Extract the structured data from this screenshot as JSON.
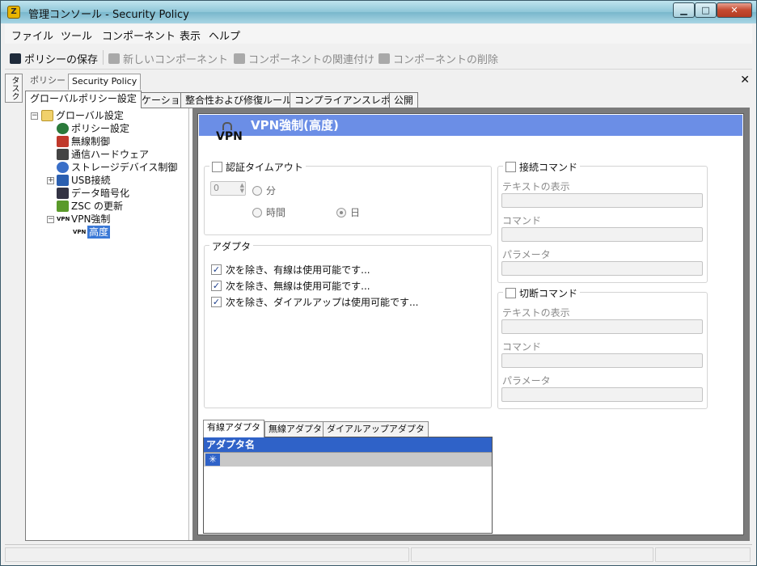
{
  "window": {
    "title": "管理コンソール - Security Policy",
    "min": "▁",
    "max": "□",
    "close": "✕"
  },
  "menu": [
    "ファイル",
    "ツール",
    "コンポーネント",
    "表示",
    "ヘルプ"
  ],
  "toolbar": {
    "save": "ポリシーの保存",
    "new_component": "新しいコンポーネント",
    "associate": "コンポーネントの関連付け",
    "delete": "コンポーネントの削除"
  },
  "sidetab": "タスク",
  "doc_tabs": [
    "ポリシー",
    "Security Policy"
  ],
  "main_tabs": [
    "グローバルポリシー設定",
    "ロケーション",
    "整合性および修復ルール",
    "コンプライアンスレポート",
    "公開"
  ],
  "tree": {
    "root": "グローバル設定",
    "items": [
      "ポリシー設定",
      "無線制御",
      "通信ハードウェア",
      "ストレージデバイス制御",
      "USB接続",
      "データ暗号化",
      "ZSC の更新",
      "VPN強制"
    ],
    "sub": "高度"
  },
  "panel": {
    "logo": "VPN",
    "header": "VPN強制(高度)",
    "auth_timeout": {
      "label": "認証タイムアウト",
      "spinner_value": "0",
      "minutes": "分",
      "hours": "時間",
      "days": "日",
      "selected": "日"
    },
    "adapter": {
      "label": "アダプタ",
      "options": [
        "次を除き、有線は使用可能です...",
        "次を除き、無線は使用可能です...",
        "次を除き、ダイアルアップは使用可能です..."
      ]
    },
    "connect_cmd": {
      "label": "接続コマンド",
      "display_text": "テキストの表示",
      "command": "コマンド",
      "params": "パラメータ"
    },
    "disconnect_cmd": {
      "label": "切断コマンド",
      "display_text": "テキストの表示",
      "command": "コマンド",
      "params": "パラメータ"
    },
    "bottom_tabs": [
      "有線アダプタ",
      "無線アダプタ",
      "ダイアルアップアダプタ"
    ],
    "grid": {
      "header": "アダプタ名",
      "new_row": "✳"
    }
  }
}
